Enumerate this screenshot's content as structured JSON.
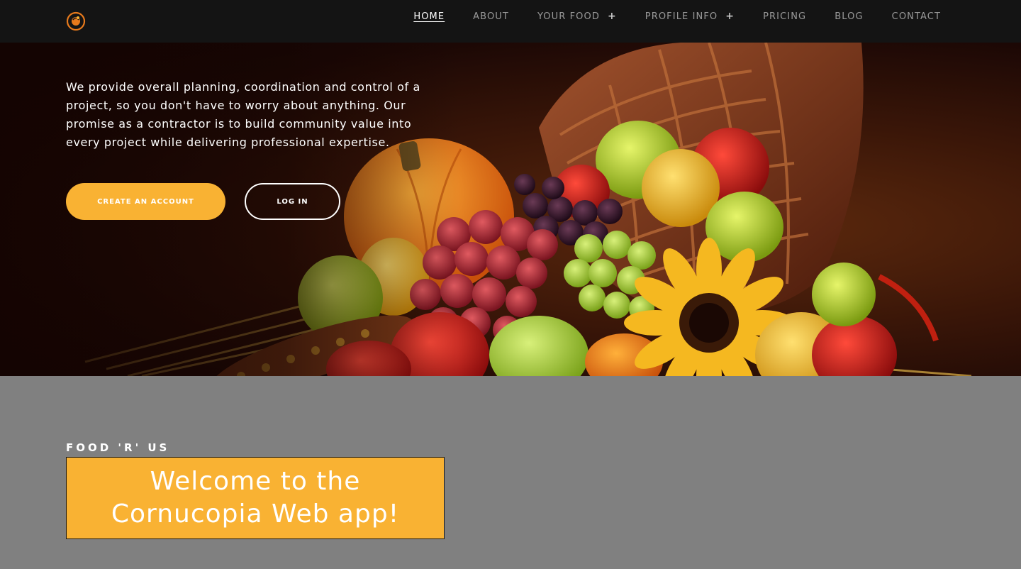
{
  "nav": {
    "items": [
      {
        "label": "HOME",
        "active": true,
        "expandable": false
      },
      {
        "label": "ABOUT",
        "active": false,
        "expandable": false
      },
      {
        "label": "YOUR FOOD",
        "active": false,
        "expandable": true
      },
      {
        "label": "PROFILE INFO",
        "active": false,
        "expandable": true
      },
      {
        "label": "PRICING",
        "active": false,
        "expandable": false
      },
      {
        "label": "BLOG",
        "active": false,
        "expandable": false
      },
      {
        "label": "CONTACT",
        "active": false,
        "expandable": false
      }
    ],
    "plus_symbol": "+"
  },
  "hero": {
    "description": "We provide overall planning, coordination and control of a project, so you don't have to worry about anything. Our promise as a contractor is to build community value into every project while delivering professional expertise.",
    "create_account_label": "CREATE AN ACCOUNT",
    "login_label": "LOG IN"
  },
  "intro": {
    "eyebrow": "FOOD 'R' US",
    "welcome": "Welcome to the Cornucopia Web app!"
  },
  "colors": {
    "accent": "#f9b233",
    "header_bg": "#141414",
    "section_bg": "#808080"
  },
  "icons": {
    "logo": "cornucopia-logo-icon",
    "hero": "cornucopia-basket-icon"
  }
}
